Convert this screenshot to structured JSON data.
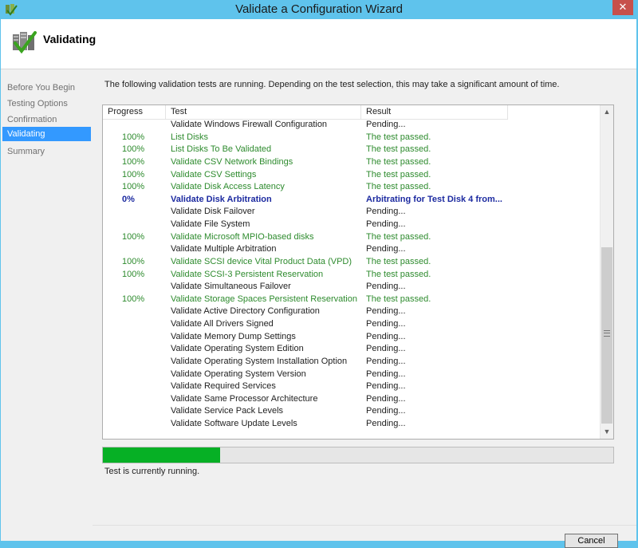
{
  "window": {
    "title": "Validate a Configuration Wizard",
    "close_label": "✕"
  },
  "header": {
    "title": "Validating",
    "icon": "cluster-validate-icon"
  },
  "nav": {
    "items": [
      {
        "label": "Before You Begin",
        "active": false
      },
      {
        "label": "Testing Options",
        "active": false
      },
      {
        "label": "Confirmation",
        "active": false
      },
      {
        "label": "Validating",
        "active": true
      },
      {
        "label": "Summary",
        "active": false
      }
    ]
  },
  "content": {
    "description": "The following validation tests are running. Depending on the test selection, this may take a significant amount of time."
  },
  "table": {
    "columns": [
      "Progress",
      "Test",
      "Result"
    ],
    "rows": [
      {
        "progress": "",
        "test": "Validate Windows Firewall Configuration",
        "result": "Pending...",
        "state": "pending"
      },
      {
        "progress": "100%",
        "test": "List Disks",
        "result": "The test passed.",
        "state": "passed"
      },
      {
        "progress": "100%",
        "test": "List Disks To Be Validated",
        "result": "The test passed.",
        "state": "passed"
      },
      {
        "progress": "100%",
        "test": "Validate CSV Network Bindings",
        "result": "The test passed.",
        "state": "passed"
      },
      {
        "progress": "100%",
        "test": "Validate CSV Settings",
        "result": "The test passed.",
        "state": "passed"
      },
      {
        "progress": "100%",
        "test": "Validate Disk Access Latency",
        "result": "The test passed.",
        "state": "passed"
      },
      {
        "progress": "0%",
        "test": "Validate Disk Arbitration",
        "result": "Arbitrating for Test Disk 4 from...",
        "state": "running"
      },
      {
        "progress": "",
        "test": "Validate Disk Failover",
        "result": "Pending...",
        "state": "pending"
      },
      {
        "progress": "",
        "test": "Validate File System",
        "result": "Pending...",
        "state": "pending"
      },
      {
        "progress": "100%",
        "test": "Validate Microsoft MPIO-based disks",
        "result": "The test passed.",
        "state": "passed"
      },
      {
        "progress": "",
        "test": "Validate Multiple Arbitration",
        "result": "Pending...",
        "state": "pending"
      },
      {
        "progress": "100%",
        "test": "Validate SCSI device Vital Product Data (VPD)",
        "result": "The test passed.",
        "state": "passed"
      },
      {
        "progress": "100%",
        "test": "Validate SCSI-3 Persistent Reservation",
        "result": "The test passed.",
        "state": "passed"
      },
      {
        "progress": "",
        "test": "Validate Simultaneous Failover",
        "result": "Pending...",
        "state": "pending"
      },
      {
        "progress": "100%",
        "test": "Validate Storage Spaces Persistent Reservation",
        "result": "The test passed.",
        "state": "passed"
      },
      {
        "progress": "",
        "test": "Validate Active Directory Configuration",
        "result": "Pending...",
        "state": "pending"
      },
      {
        "progress": "",
        "test": "Validate All Drivers Signed",
        "result": "Pending...",
        "state": "pending"
      },
      {
        "progress": "",
        "test": "Validate Memory Dump Settings",
        "result": "Pending...",
        "state": "pending"
      },
      {
        "progress": "",
        "test": "Validate Operating System Edition",
        "result": "Pending...",
        "state": "pending"
      },
      {
        "progress": "",
        "test": "Validate Operating System Installation Option",
        "result": "Pending...",
        "state": "pending"
      },
      {
        "progress": "",
        "test": "Validate Operating System Version",
        "result": "Pending...",
        "state": "pending"
      },
      {
        "progress": "",
        "test": "Validate Required Services",
        "result": "Pending...",
        "state": "pending"
      },
      {
        "progress": "",
        "test": "Validate Same Processor Architecture",
        "result": "Pending...",
        "state": "pending"
      },
      {
        "progress": "",
        "test": "Validate Service Pack Levels",
        "result": "Pending...",
        "state": "pending"
      },
      {
        "progress": "",
        "test": "Validate Software Update Levels",
        "result": "Pending...",
        "state": "pending"
      }
    ]
  },
  "progress": {
    "fraction": 0.23,
    "status": "Test is currently running."
  },
  "buttons": {
    "cancel": "Cancel"
  },
  "colors": {
    "passed": "#2e8b2e",
    "running": "#1c2aa0",
    "progress_fill": "#06b025",
    "titlebar": "#5fc3ec",
    "nav_active": "#3399ff"
  }
}
